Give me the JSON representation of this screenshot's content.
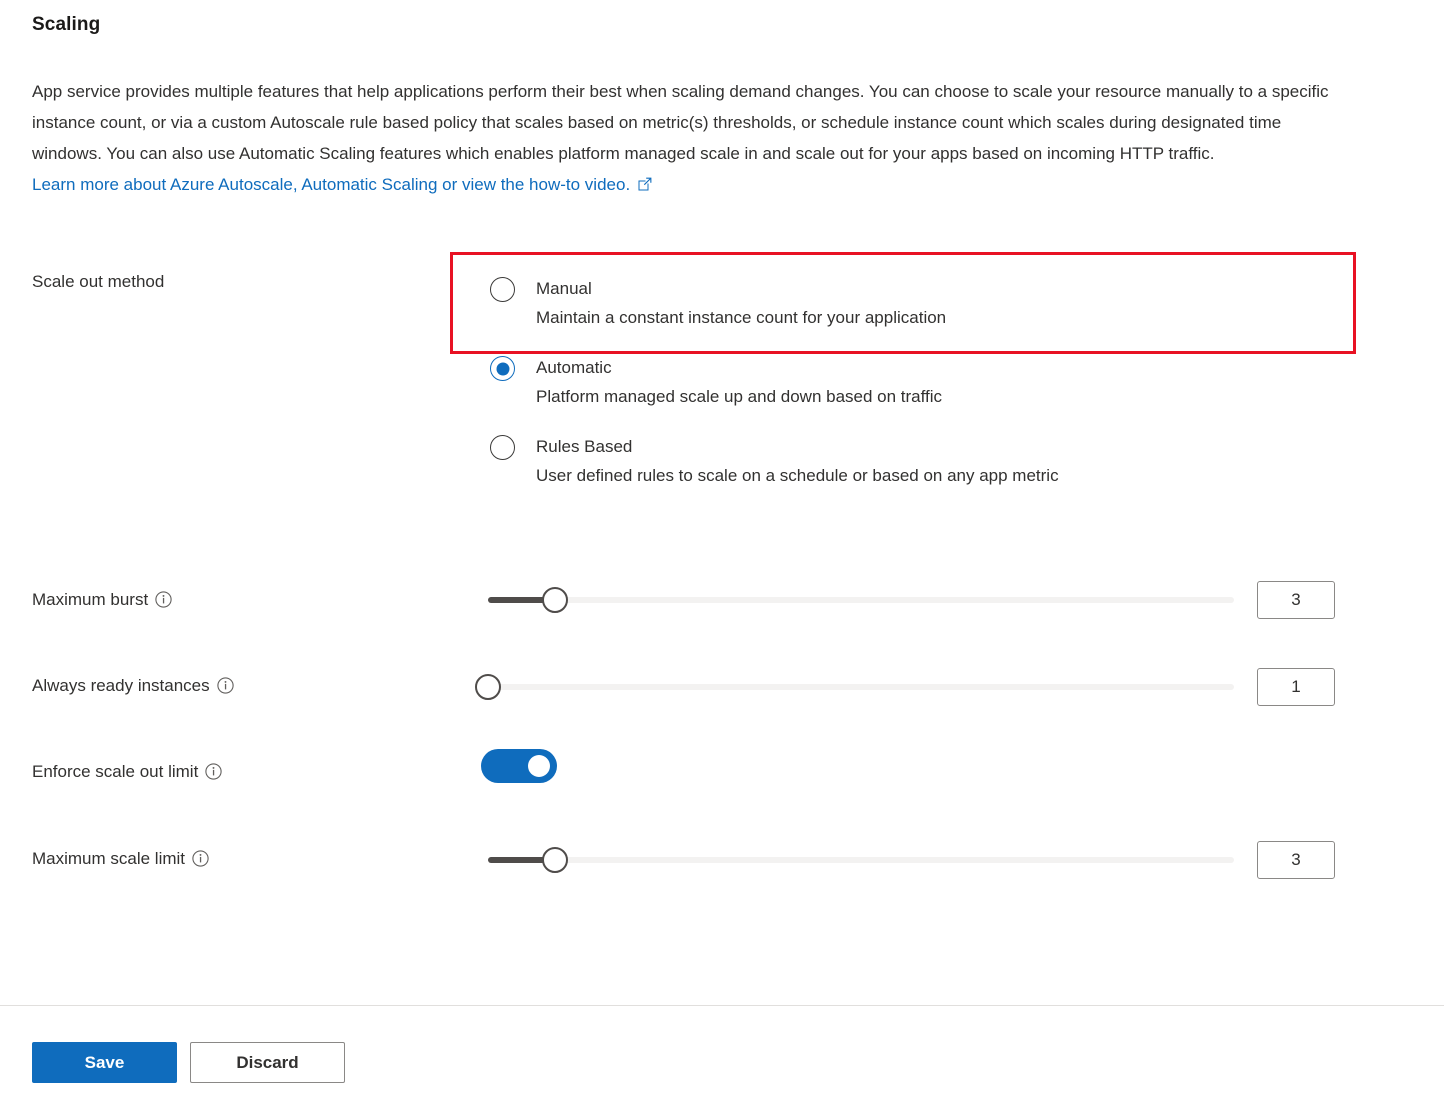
{
  "page": {
    "title": "Scaling",
    "description_paragraph": "App service provides multiple features that help applications perform their best when scaling demand changes. You can choose to scale your resource manually to a specific instance count, or via a custom Autoscale rule based policy that scales based on metric(s) thresholds, or schedule instance count which scales during designated time windows. You can also use Automatic Scaling features which enables platform managed scale in and scale out for your apps based on incoming HTTP traffic.",
    "learn_more_link": "Learn more about Azure Autoscale, Automatic Scaling or view the how-to video.",
    "external_link_icon": "external-link-icon"
  },
  "scale_out_method": {
    "label": "Scale out method",
    "selected": "Automatic",
    "options": [
      {
        "value": "manual",
        "title": "Manual",
        "description": "Maintain a constant instance count for your application",
        "checked": false,
        "highlighted": true
      },
      {
        "value": "automatic",
        "title": "Automatic",
        "description": "Platform managed scale up and down based on traffic",
        "checked": true,
        "highlighted": false
      },
      {
        "value": "rules_based",
        "title": "Rules Based",
        "description": "User defined rules to scale on a schedule or based on any app metric",
        "checked": false,
        "highlighted": false
      }
    ]
  },
  "settings": {
    "maximum_burst": {
      "label": "Maximum burst",
      "info_icon": "info-icon",
      "value": "3",
      "slider_percent": 9
    },
    "always_ready_instances": {
      "label": "Always ready instances",
      "info_icon": "info-icon",
      "value": "1",
      "slider_percent": 0
    },
    "enforce_scale_out_limit": {
      "label": "Enforce scale out limit",
      "info_icon": "info-icon",
      "toggle_on": true
    },
    "maximum_scale_limit": {
      "label": "Maximum scale limit",
      "info_icon": "info-icon",
      "value": "3",
      "slider_percent": 9
    }
  },
  "footer": {
    "save_label": "Save",
    "discard_label": "Discard"
  },
  "colors": {
    "accent_blue": "#0f6cbd",
    "link_blue": "#0f6cbd",
    "highlight_red": "#e81123",
    "slider_fill": "#4f4c4a",
    "slider_track": "#f3f2f1",
    "text": "#323130",
    "border": "#8a8886"
  }
}
